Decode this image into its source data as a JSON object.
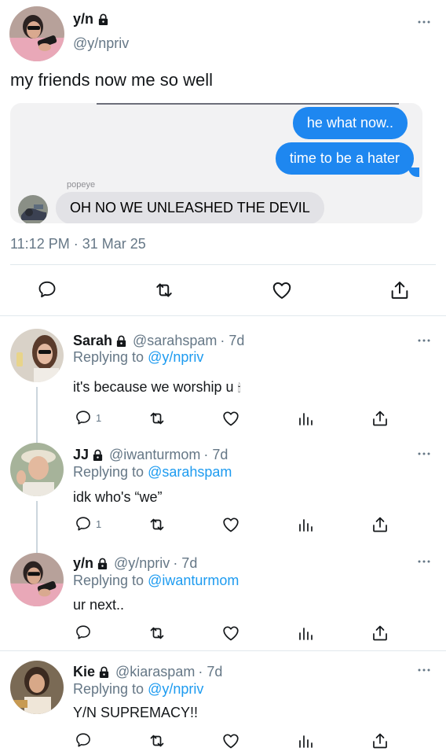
{
  "main_tweet": {
    "name": "y/n",
    "handle": "@y/npriv",
    "text": "my friends now me so well",
    "screenshot": {
      "bubble_1": "he what now..",
      "bubble_2": "time to be a hater",
      "sender_label": "popeye",
      "bubble_3": "OH NO WE UNLEASHED THE DEVIL"
    },
    "timestamp": "11:12 PM · 31 Mar 25"
  },
  "replies": [
    {
      "name": "Sarah",
      "handle": "@sarahspam",
      "time": "· 7d",
      "replying_prefix": "Replying to",
      "replying_to": "@y/npriv",
      "text": "it's because we worship u",
      "emoji": "🕯",
      "reply_count": "1"
    },
    {
      "name": "JJ",
      "handle": "@iwanturmom",
      "time": "· 7d",
      "replying_prefix": "Replying to",
      "replying_to": "@sarahspam",
      "text": "idk who's “we”",
      "reply_count": "1"
    },
    {
      "name": "y/n",
      "handle": "@y/npriv",
      "time": "· 7d",
      "replying_prefix": "Replying to",
      "replying_to": "@iwanturmom",
      "text": "ur next..",
      "reply_count": ""
    },
    {
      "name": "Kie",
      "handle": "@kiaraspam",
      "time": "· 7d",
      "replying_prefix": "Replying to",
      "replying_to": "@y/npriv",
      "text": "Y/N SUPREMACY!!",
      "reply_count": ""
    }
  ],
  "colors": {
    "accent": "#1d9bf0",
    "imessage_blue": "#1e87f0",
    "gray_text": "#657786"
  }
}
